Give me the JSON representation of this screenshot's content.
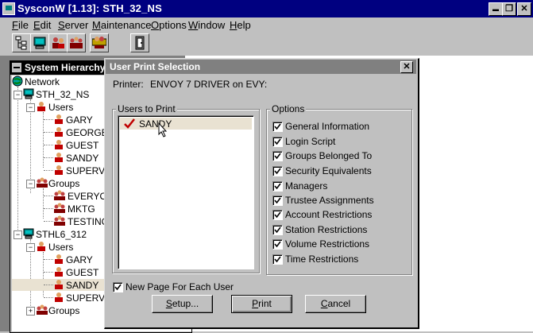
{
  "app": {
    "title": "SysconW [1.13]:  STH_32_NS",
    "controls": {
      "minimize": "▬",
      "restore": "❐",
      "close": "✕"
    }
  },
  "menu": [
    {
      "label": "File",
      "u": "F",
      "rest": "ile"
    },
    {
      "label": "Edit",
      "u": "E",
      "rest": "dit"
    },
    {
      "label": "Server",
      "u": "S",
      "rest": "erver"
    },
    {
      "label": "Maintenance",
      "u": "M",
      "rest": "aintenance"
    },
    {
      "label": "Options",
      "u": "O",
      "rest": "ptions"
    },
    {
      "label": "Window",
      "u": "W",
      "rest": "indow"
    },
    {
      "label": "Help",
      "u": "H",
      "rest": "elp"
    }
  ],
  "toolbar": [
    "hierarchy-icon",
    "server-icon",
    "users-icon",
    "groups-icon",
    "print-server-icon"
  ],
  "hierarchy": {
    "title": "System Hierarchy",
    "nodes": {
      "network": "Network",
      "server1": "STH_32_NS",
      "users1": "Users",
      "gary1": "GARY",
      "george": "GEORGE",
      "guest1": "GUEST",
      "sandy1": "SANDY",
      "supervisor1": "SUPERVISO",
      "groups1": "Groups",
      "everyone": "EVERYONE",
      "mktg": "MKTG",
      "testing": "TESTING",
      "server2": "STHL6_312",
      "users2": "Users",
      "gary2": "GARY",
      "guest2": "GUEST",
      "sandy2": "SANDY",
      "supervisor2": "SUPERVISO",
      "groups2": "Groups"
    }
  },
  "dialog": {
    "title": "User Print Selection",
    "close": "✕",
    "printer_label": "Printer:",
    "printer_value": "ENVOY 7 DRIVER on EVY:",
    "users_group_title": "Users to Print",
    "users": [
      "SANDY"
    ],
    "options_group_title": "Options",
    "options": [
      {
        "label": "General Information",
        "checked": true
      },
      {
        "label": "Login Script",
        "checked": true
      },
      {
        "label": "Groups Belonged To",
        "checked": true
      },
      {
        "label": "Security Equivalents",
        "checked": true
      },
      {
        "label": "Managers",
        "checked": true
      },
      {
        "label": "Trustee Assignments",
        "checked": true
      },
      {
        "label": "Account Restrictions",
        "checked": true
      },
      {
        "label": "Station Restrictions",
        "checked": true
      },
      {
        "label": "Volume Restrictions",
        "checked": true
      },
      {
        "label": "Time Restrictions",
        "checked": true
      }
    ],
    "new_page_label": "New Page For Each User",
    "new_page_checked": true,
    "buttons": {
      "setup": {
        "u": "S",
        "rest": "etup..."
      },
      "print": {
        "u": "P",
        "rest": "rint"
      },
      "cancel": {
        "u": "C",
        "rest": "ancel"
      }
    }
  },
  "colors": {
    "title_active": "#000080",
    "title_inactive": "#808080",
    "selection": "#e9e2d2",
    "check": "#c00000"
  }
}
